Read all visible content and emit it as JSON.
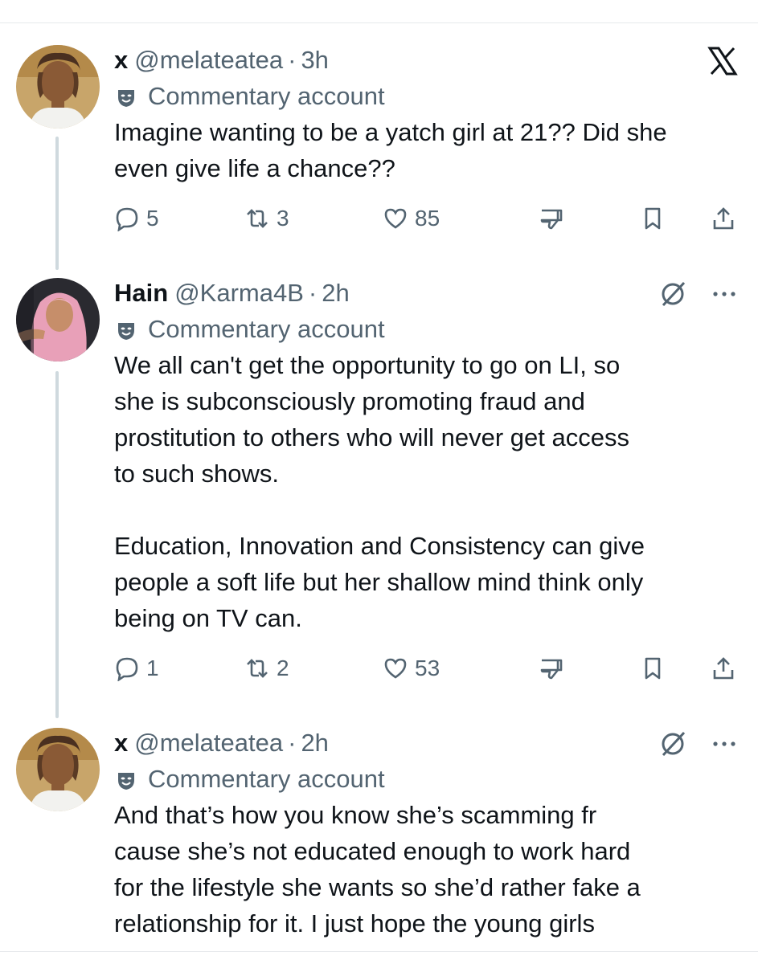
{
  "tweets": [
    {
      "display_name": "x",
      "handle": "@melateatea",
      "separator": "·",
      "time": "3h",
      "label": "Commentary account",
      "text": "Imagine wanting to be a yatch girl at 21?? Did she\neven give life a chance??",
      "replies": "5",
      "reposts": "3",
      "likes": "85",
      "corner": "x-logo-icon"
    },
    {
      "display_name": "Hain",
      "handle": "@Karma4B",
      "separator": "·",
      "time": "2h",
      "label": "Commentary account",
      "text": "We all can't get the opportunity to go on LI, so\nshe is subconsciously promoting fraud and\nprostitution to others who will never get access\nto such shows.\n\nEducation, Innovation and Consistency can give\npeople a soft life but her shallow mind think only\nbeing on TV can.",
      "replies": "1",
      "reposts": "2",
      "likes": "53",
      "corner": "grok-icon"
    },
    {
      "display_name": "x",
      "handle": "@melateatea",
      "separator": "·",
      "time": "2h",
      "label": "Commentary account",
      "text": "And that’s how you know she’s scamming fr\ncause she’s not educated enough to work hard\nfor the lifestyle she wants so she’d rather fake a\nrelationship for it. I just hope the young girls",
      "corner": "grok-icon"
    }
  ],
  "colors": {
    "text": "#0f1419",
    "secondary": "#536471",
    "thread_line": "#cfd9de",
    "divider": "#e6e9ec"
  }
}
